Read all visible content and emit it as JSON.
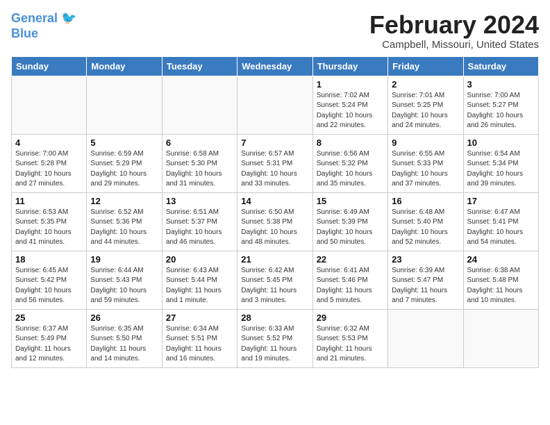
{
  "logo": {
    "line1": "General",
    "line2": "Blue"
  },
  "header": {
    "month_year": "February 2024",
    "location": "Campbell, Missouri, United States"
  },
  "weekdays": [
    "Sunday",
    "Monday",
    "Tuesday",
    "Wednesday",
    "Thursday",
    "Friday",
    "Saturday"
  ],
  "weeks": [
    [
      {
        "day": "",
        "info": ""
      },
      {
        "day": "",
        "info": ""
      },
      {
        "day": "",
        "info": ""
      },
      {
        "day": "",
        "info": ""
      },
      {
        "day": "1",
        "info": "Sunrise: 7:02 AM\nSunset: 5:24 PM\nDaylight: 10 hours\nand 22 minutes."
      },
      {
        "day": "2",
        "info": "Sunrise: 7:01 AM\nSunset: 5:25 PM\nDaylight: 10 hours\nand 24 minutes."
      },
      {
        "day": "3",
        "info": "Sunrise: 7:00 AM\nSunset: 5:27 PM\nDaylight: 10 hours\nand 26 minutes."
      }
    ],
    [
      {
        "day": "4",
        "info": "Sunrise: 7:00 AM\nSunset: 5:28 PM\nDaylight: 10 hours\nand 27 minutes."
      },
      {
        "day": "5",
        "info": "Sunrise: 6:59 AM\nSunset: 5:29 PM\nDaylight: 10 hours\nand 29 minutes."
      },
      {
        "day": "6",
        "info": "Sunrise: 6:58 AM\nSunset: 5:30 PM\nDaylight: 10 hours\nand 31 minutes."
      },
      {
        "day": "7",
        "info": "Sunrise: 6:57 AM\nSunset: 5:31 PM\nDaylight: 10 hours\nand 33 minutes."
      },
      {
        "day": "8",
        "info": "Sunrise: 6:56 AM\nSunset: 5:32 PM\nDaylight: 10 hours\nand 35 minutes."
      },
      {
        "day": "9",
        "info": "Sunrise: 6:55 AM\nSunset: 5:33 PM\nDaylight: 10 hours\nand 37 minutes."
      },
      {
        "day": "10",
        "info": "Sunrise: 6:54 AM\nSunset: 5:34 PM\nDaylight: 10 hours\nand 39 minutes."
      }
    ],
    [
      {
        "day": "11",
        "info": "Sunrise: 6:53 AM\nSunset: 5:35 PM\nDaylight: 10 hours\nand 41 minutes."
      },
      {
        "day": "12",
        "info": "Sunrise: 6:52 AM\nSunset: 5:36 PM\nDaylight: 10 hours\nand 44 minutes."
      },
      {
        "day": "13",
        "info": "Sunrise: 6:51 AM\nSunset: 5:37 PM\nDaylight: 10 hours\nand 46 minutes."
      },
      {
        "day": "14",
        "info": "Sunrise: 6:50 AM\nSunset: 5:38 PM\nDaylight: 10 hours\nand 48 minutes."
      },
      {
        "day": "15",
        "info": "Sunrise: 6:49 AM\nSunset: 5:39 PM\nDaylight: 10 hours\nand 50 minutes."
      },
      {
        "day": "16",
        "info": "Sunrise: 6:48 AM\nSunset: 5:40 PM\nDaylight: 10 hours\nand 52 minutes."
      },
      {
        "day": "17",
        "info": "Sunrise: 6:47 AM\nSunset: 5:41 PM\nDaylight: 10 hours\nand 54 minutes."
      }
    ],
    [
      {
        "day": "18",
        "info": "Sunrise: 6:45 AM\nSunset: 5:42 PM\nDaylight: 10 hours\nand 56 minutes."
      },
      {
        "day": "19",
        "info": "Sunrise: 6:44 AM\nSunset: 5:43 PM\nDaylight: 10 hours\nand 59 minutes."
      },
      {
        "day": "20",
        "info": "Sunrise: 6:43 AM\nSunset: 5:44 PM\nDaylight: 11 hours\nand 1 minute."
      },
      {
        "day": "21",
        "info": "Sunrise: 6:42 AM\nSunset: 5:45 PM\nDaylight: 11 hours\nand 3 minutes."
      },
      {
        "day": "22",
        "info": "Sunrise: 6:41 AM\nSunset: 5:46 PM\nDaylight: 11 hours\nand 5 minutes."
      },
      {
        "day": "23",
        "info": "Sunrise: 6:39 AM\nSunset: 5:47 PM\nDaylight: 11 hours\nand 7 minutes."
      },
      {
        "day": "24",
        "info": "Sunrise: 6:38 AM\nSunset: 5:48 PM\nDaylight: 11 hours\nand 10 minutes."
      }
    ],
    [
      {
        "day": "25",
        "info": "Sunrise: 6:37 AM\nSunset: 5:49 PM\nDaylight: 11 hours\nand 12 minutes."
      },
      {
        "day": "26",
        "info": "Sunrise: 6:35 AM\nSunset: 5:50 PM\nDaylight: 11 hours\nand 14 minutes."
      },
      {
        "day": "27",
        "info": "Sunrise: 6:34 AM\nSunset: 5:51 PM\nDaylight: 11 hours\nand 16 minutes."
      },
      {
        "day": "28",
        "info": "Sunrise: 6:33 AM\nSunset: 5:52 PM\nDaylight: 11 hours\nand 19 minutes."
      },
      {
        "day": "29",
        "info": "Sunrise: 6:32 AM\nSunset: 5:53 PM\nDaylight: 11 hours\nand 21 minutes."
      },
      {
        "day": "",
        "info": ""
      },
      {
        "day": "",
        "info": ""
      }
    ]
  ]
}
